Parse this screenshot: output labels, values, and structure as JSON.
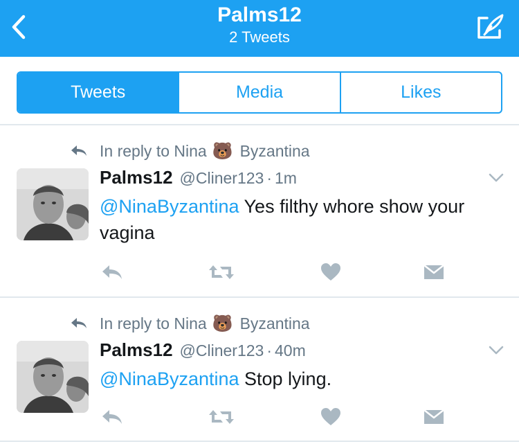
{
  "header": {
    "title": "Palms12",
    "subtitle": "2 Tweets",
    "back_icon": "chevron-left-icon",
    "compose_icon": "compose-tweet-icon",
    "background_color": "#1da1f2"
  },
  "tabs": [
    {
      "label": "Tweets",
      "active": true
    },
    {
      "label": "Media",
      "active": false
    },
    {
      "label": "Likes",
      "active": false
    }
  ],
  "tweets": [
    {
      "reply_prefix": "In reply to Nina",
      "reply_emoji": "🐻",
      "reply_suffix": "Byzantina",
      "name": "Palms12",
      "handle": "@Cliner123",
      "separator": "·",
      "time": "1m",
      "mention": "@NinaByzantina",
      "text": " Yes filthy whore show your vagina"
    },
    {
      "reply_prefix": "In reply to Nina",
      "reply_emoji": "🐻",
      "reply_suffix": "Byzantina",
      "name": "Palms12",
      "handle": "@Cliner123",
      "separator": "·",
      "time": "40m",
      "mention": "@NinaByzantina",
      "text": " Stop lying."
    }
  ],
  "colors": {
    "accent": "#1da1f2",
    "muted": "#657786",
    "icon_gray": "#aab8c2",
    "divider": "#e1e8ed"
  }
}
